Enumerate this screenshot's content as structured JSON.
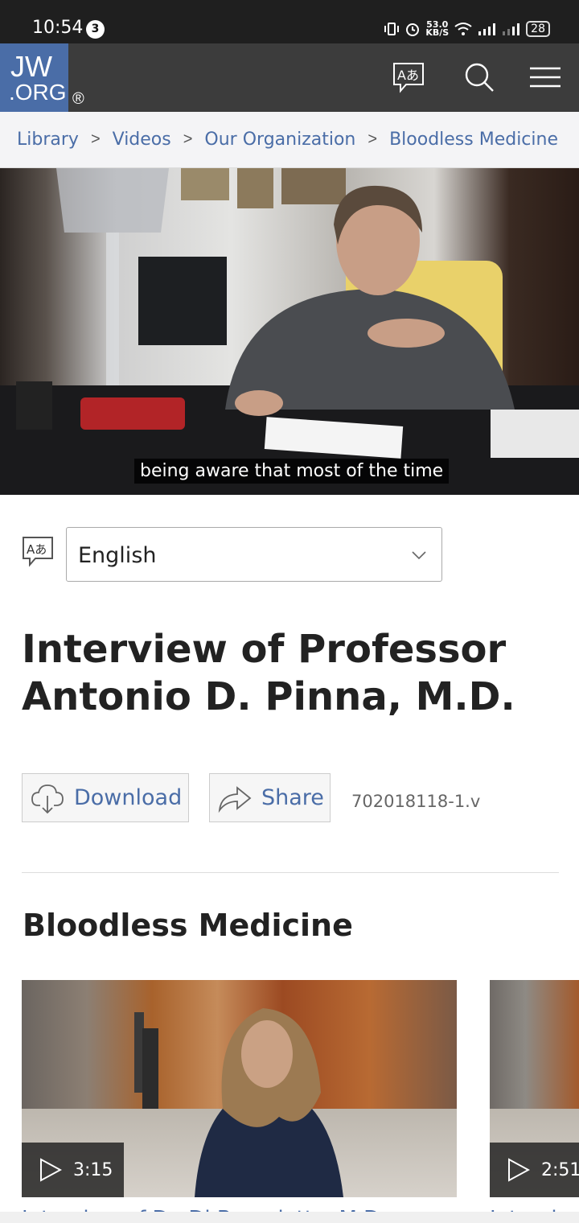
{
  "status_bar": {
    "time": "10:54",
    "notification_count": "3",
    "net_speed_value": "53.0",
    "net_speed_unit": "KB/S",
    "battery": "28"
  },
  "header": {
    "logo_top": "JW",
    "logo_bottom": ".ORG",
    "logo_registered": "®",
    "icons": [
      "translate-icon",
      "search-icon",
      "menu-icon"
    ]
  },
  "breadcrumb": {
    "items": [
      "Library",
      "Videos",
      "Our Organization",
      "Bloodless Medicine"
    ]
  },
  "video": {
    "caption": "being aware that most of the time"
  },
  "language": {
    "selected": "English"
  },
  "title": "Interview of Professor Antonio D. Pinna, M.D.",
  "actions": {
    "download_label": "Download",
    "share_label": "Share",
    "video_id": "702018118-1.v"
  },
  "section": {
    "title": "Bloodless Medicine",
    "videos": [
      {
        "duration": "3:15",
        "title_peek": "Interview of Dr. Di Benedetto, M.D."
      },
      {
        "duration": "2:51",
        "title_peek": "Interview"
      }
    ]
  },
  "colors": {
    "brand": "#4a6da7",
    "header_bg": "#3c3c3c",
    "link": "#4a6da7"
  }
}
